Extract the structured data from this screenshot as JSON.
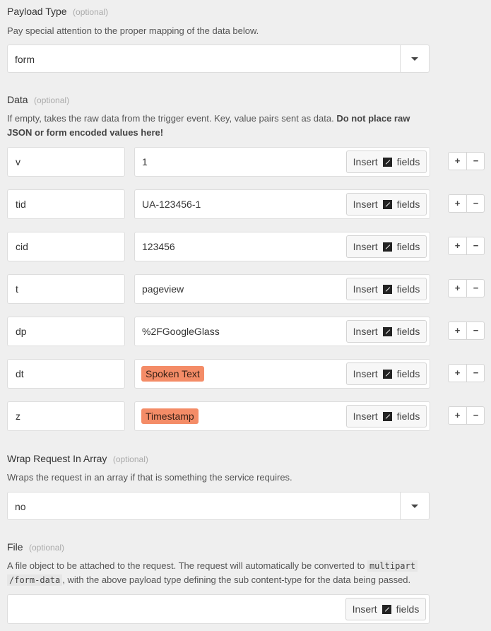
{
  "payload_type": {
    "label": "Payload Type",
    "optional": "(optional)",
    "help": "Pay special attention to the proper mapping of the data below.",
    "value": "form"
  },
  "data": {
    "label": "Data",
    "optional": "(optional)",
    "help_plain": "If empty, takes the raw data from the trigger event. Key, value pairs sent as data. ",
    "help_bold": "Do not place raw JSON or form encoded values here!",
    "insert_label": "Insert",
    "fields_label": "fields",
    "plus": "+",
    "minus": "−",
    "rows": [
      {
        "key": "v",
        "value": "1",
        "token": false
      },
      {
        "key": "tid",
        "value": "UA-123456-1",
        "token": false
      },
      {
        "key": "cid",
        "value": "123456",
        "token": false
      },
      {
        "key": "t",
        "value": "pageview",
        "token": false
      },
      {
        "key": "dp",
        "value": "%2FGoogleGlass",
        "token": false
      },
      {
        "key": "dt",
        "value": "Spoken Text",
        "token": true
      },
      {
        "key": "z",
        "value": "Timestamp",
        "token": true
      }
    ]
  },
  "wrap": {
    "label": "Wrap Request In Array",
    "optional": "(optional)",
    "help": "Wraps the request in an array if that is something the service requires.",
    "value": "no"
  },
  "file": {
    "label": "File",
    "optional": "(optional)",
    "help_1": "A file object to be attached to the request. The request will automatically be converted to ",
    "code_1": "multipart",
    "code_2": "/form-data",
    "help_2": ", with the above payload type defining the sub content-type for the data being passed.",
    "insert_label": "Insert",
    "fields_label": "fields"
  },
  "colors": {
    "token_bg": "#f48c67",
    "page_bg": "#efefef"
  }
}
